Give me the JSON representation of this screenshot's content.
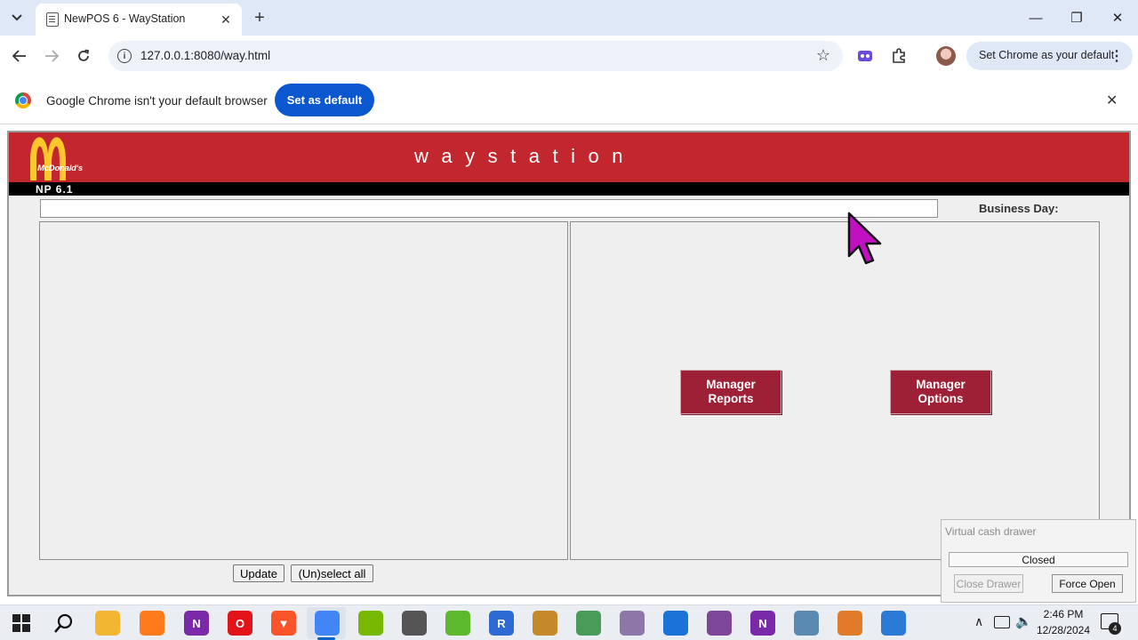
{
  "browser": {
    "tab_title": "NewPOS 6 - WayStation",
    "tab_icon": "page-icon",
    "url": "127.0.0.1:8080/way.html",
    "set_default_pill": "Set Chrome as your default",
    "window_controls": {
      "minimize": "—",
      "restore": "❐",
      "close": "✕"
    }
  },
  "infobar": {
    "message": "Google Chrome isn't your default browser",
    "button": "Set as default"
  },
  "app": {
    "brand": "McDonald's",
    "name": "waystation",
    "version": "NP 6.1",
    "business_day_label": "Business Day:",
    "manager_reports": "Manager Reports",
    "manager_options": "Manager Options",
    "update_button": "Update",
    "unselect_button": "(Un)select all",
    "colors": {
      "brand_red": "#c1272d",
      "button_red": "#9e2036",
      "arches_yellow": "#ffc72c"
    }
  },
  "cash_drawer": {
    "title": "Virtual cash drawer",
    "status": "Closed",
    "close_button": "Close Drawer",
    "force_button": "Force Open"
  },
  "taskbar": {
    "time": "2:46 PM",
    "date": "12/28/2024",
    "notification_count": "4",
    "apps": [
      {
        "name": "file-explorer-icon",
        "color": "#f2b632",
        "glyph": ""
      },
      {
        "name": "firefox-icon",
        "color": "#ff7a1a",
        "glyph": ""
      },
      {
        "name": "onenote-icon",
        "color": "#7a2aa8",
        "glyph": "N"
      },
      {
        "name": "opera-icon",
        "color": "#e3131a",
        "glyph": "O"
      },
      {
        "name": "brave-icon",
        "color": "#fb542b",
        "glyph": "▼"
      },
      {
        "name": "chrome-icon",
        "color": "#4285f4",
        "glyph": ""
      },
      {
        "name": "nvidia-icon",
        "color": "#76b900",
        "glyph": ""
      },
      {
        "name": "video-editor-icon",
        "color": "#555555",
        "glyph": ""
      },
      {
        "name": "pea-app-icon",
        "color": "#5cb82c",
        "glyph": ""
      },
      {
        "name": "remote-desktop-icon",
        "color": "#2d6bd3",
        "glyph": "R"
      },
      {
        "name": "game-icon",
        "color": "#c48a2a",
        "glyph": ""
      },
      {
        "name": "image-tool-icon",
        "color": "#4a9a5a",
        "glyph": ""
      },
      {
        "name": "ghost-app-icon",
        "color": "#8d77a8",
        "glyph": ""
      },
      {
        "name": "shield-app-icon",
        "color": "#1a73d6",
        "glyph": ""
      },
      {
        "name": "tor-browser-icon",
        "color": "#7d4698",
        "glyph": ""
      },
      {
        "name": "onenote2-icon",
        "color": "#7a2aa8",
        "glyph": "N"
      },
      {
        "name": "drive-tool-icon",
        "color": "#5a8ab0",
        "glyph": ""
      },
      {
        "name": "food-app-icon",
        "color": "#e07b2a",
        "glyph": ""
      },
      {
        "name": "window-app-icon",
        "color": "#2b7bd6",
        "glyph": ""
      }
    ]
  }
}
